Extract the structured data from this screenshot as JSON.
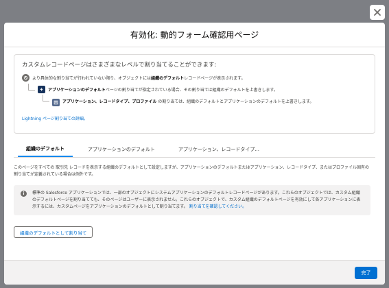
{
  "modal": {
    "title": "有効化: 動的フォーム確認用ページ",
    "close_icon": "close-icon"
  },
  "info_card": {
    "title": "カスタムレコードページはさまざまなレベルで割り当てることができます:",
    "row1": {
      "pre": "より具体的な割り当てが行われていない限り、オブジェクトには ",
      "bold": "組織のデフォルト",
      "post": " レコードページが表示されます。"
    },
    "row2": {
      "bold": "アプリケーションのデフォルト",
      "post": " ページの割り当てが指定されている場合、その割り当ては組織のデフォルトを上書きします。"
    },
    "row3": {
      "bold": "アプリケーション、レコードタイプ、プロファイル",
      "post": " の割り当ては、組織のデフォルトとアプリケーションのデフォルトを上書きします。"
    },
    "link": "Lightning ページ割り当ての詳細。"
  },
  "tabs": [
    {
      "label": "組織のデフォルト",
      "active": true
    },
    {
      "label": "アプリケーションのデフォルト",
      "active": false
    },
    {
      "label": "アプリケーション、レコードタイプ...",
      "active": false
    }
  ],
  "description": "このページをすべての 取引先 レコードを表示する組織のデフォルトとして設定しますが、アプリケーションのデフォルトまたはアプリケーション、レコードタイプ、またはプロファイル固有の割り当てが定義されている場合は例外です。",
  "note": {
    "text": "標準の Salesforce アプリケーションでは、一部のオブジェクトにシステムアプリケーションのデフォルトレコードページがあります。これらのオブジェクトでは、カスタム組織のデフォルトページを割り当てても、そのページはユーザーに表示されません。これらのオブジェクトで、カスタム組織のデフォルトページを有効にして各アプリケーションに表示するには、カスタムページをアプリケーションのデフォルトとして割り当てます。",
    "link": "割り当てを確認してください。"
  },
  "assign_button": "組織のデフォルトとして割り当て",
  "footer": {
    "done_button": "完了"
  }
}
